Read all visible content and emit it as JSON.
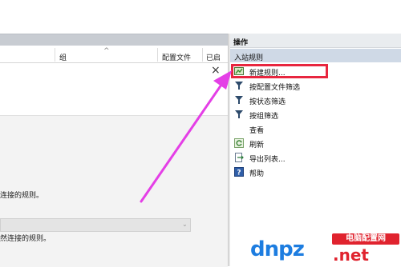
{
  "table": {
    "columns": [
      "组",
      "配置文件",
      "已启"
    ]
  },
  "left": {
    "text_connection_rules_1": "连接的规则。",
    "text_connection_rules_2": "然连接的规则。"
  },
  "actions": {
    "title": "操作",
    "section": "入站规则",
    "items": [
      {
        "label": "新建规则...",
        "icon": "new-rule-icon"
      },
      {
        "label": "按配置文件筛选",
        "icon": "filter-icon"
      },
      {
        "label": "按状态筛选",
        "icon": "filter-icon"
      },
      {
        "label": "按组筛选",
        "icon": "filter-icon"
      },
      {
        "label": "查看",
        "icon": "none"
      },
      {
        "label": "刷新",
        "icon": "refresh-icon"
      },
      {
        "label": "导出列表...",
        "icon": "export-icon"
      },
      {
        "label": "帮助",
        "icon": "help-icon"
      }
    ]
  },
  "watermark": {
    "top": "电脑配置网",
    "main": "dnpz",
    "suffix": ".net"
  },
  "colors": {
    "highlight": "#e8263f",
    "arrow": "#e43fe6",
    "section_bg": "#cfd9e6"
  }
}
